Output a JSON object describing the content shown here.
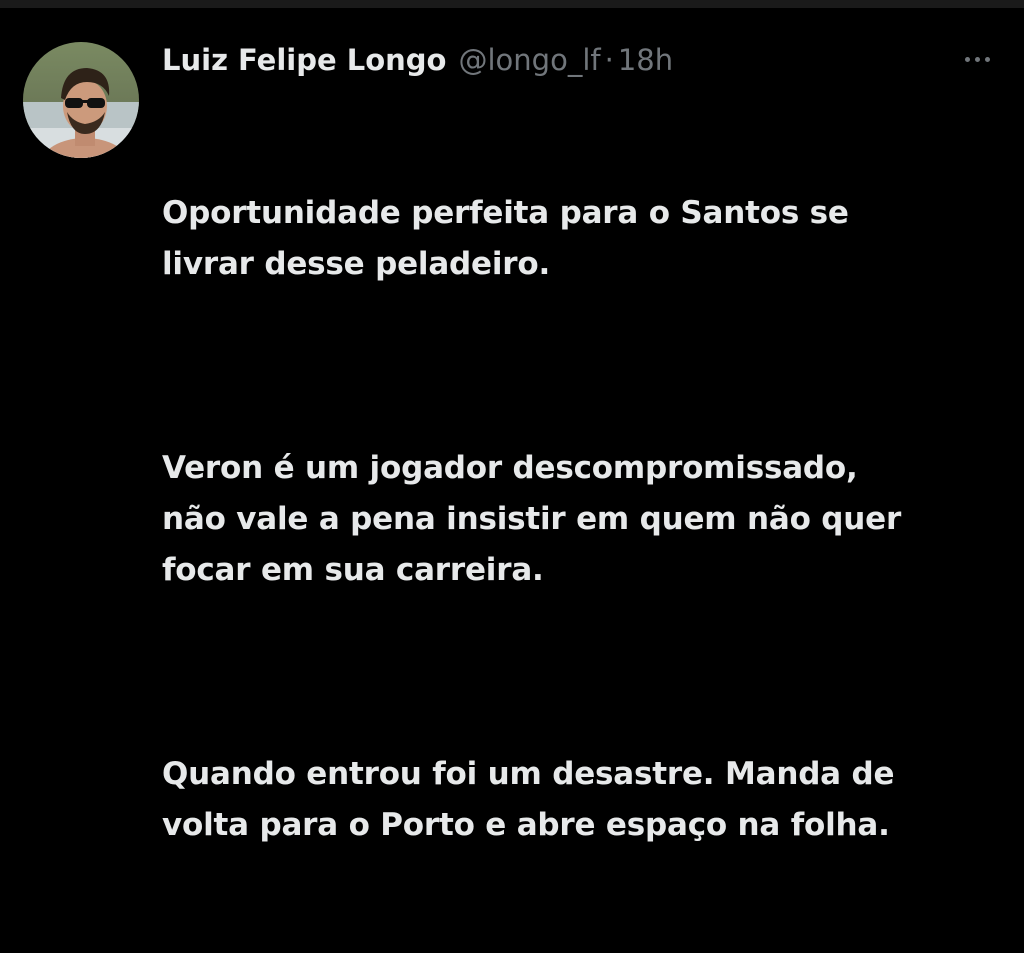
{
  "tweet": {
    "author": {
      "display_name": "Luiz Felipe Longo",
      "handle": "@longo_lf",
      "avatar_icon": "profile-photo-avatar"
    },
    "separator": "·",
    "timestamp": "18h",
    "more_icon": "more-horizontal-icon",
    "paragraphs": [
      "Oportunidade perfeita para o Santos se\nlivrar desse peladeiro.",
      "Veron é um jogador descompromissado,\nnão vale a pena insistir em quem não quer\nfocar em sua carreira.",
      "Quando entrou foi um desastre. Manda de\nvolta para o Porto e abre espaço na folha."
    ]
  },
  "colors": {
    "background": "#000000",
    "primary_text": "#e7e9ea",
    "secondary_text": "#71767b"
  }
}
